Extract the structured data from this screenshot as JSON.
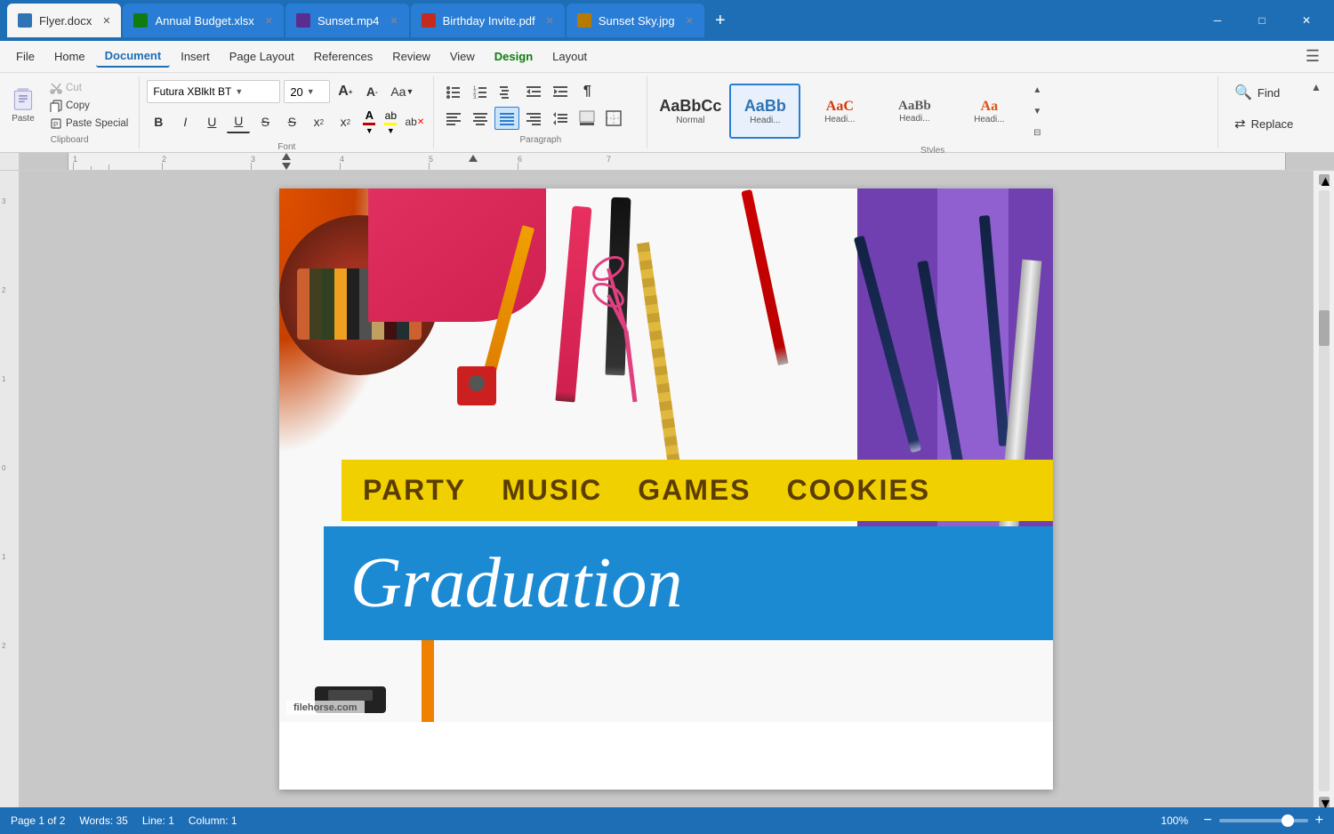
{
  "titlebar": {
    "tabs": [
      {
        "id": "flyer",
        "label": "Flyer.docx",
        "icon_color": "#1e6eb5",
        "active": true
      },
      {
        "id": "budget",
        "label": "Annual Budget.xlsx",
        "icon_color": "#107c10",
        "active": false
      },
      {
        "id": "sunset",
        "label": "Sunset.mp4",
        "icon_color": "#5c2d91",
        "active": false
      },
      {
        "id": "birthday",
        "label": "Birthday Invite.pdf",
        "icon_color": "#c42b1c",
        "active": false
      },
      {
        "id": "sunsetjpg",
        "label": "Sunset Sky.jpg",
        "icon_color": "#b77a00",
        "active": false
      }
    ],
    "add_tab": "+",
    "win_minimize": "─",
    "win_maximize": "□",
    "win_close": "✕"
  },
  "menubar": {
    "items": [
      {
        "id": "file",
        "label": "File"
      },
      {
        "id": "home",
        "label": "Home"
      },
      {
        "id": "document",
        "label": "Document",
        "active": true
      },
      {
        "id": "insert",
        "label": "Insert"
      },
      {
        "id": "pagelayout",
        "label": "Page Layout"
      },
      {
        "id": "references",
        "label": "References"
      },
      {
        "id": "review",
        "label": "Review"
      },
      {
        "id": "view",
        "label": "View"
      },
      {
        "id": "design",
        "label": "Design",
        "design": true
      },
      {
        "id": "layout",
        "label": "Layout"
      }
    ]
  },
  "ribbon": {
    "paste": {
      "paste_label": "Paste",
      "cut_label": "Cut",
      "copy_label": "Copy",
      "paste_special_label": "Paste Special"
    },
    "font": {
      "font_name": "Futura XBlkIt BT",
      "font_size": "20",
      "bold_label": "B",
      "italic_label": "I",
      "underline_label": "U",
      "strikethrough_label": "S",
      "double_underline_label": "U",
      "double_strikethrough_label": "S",
      "superscript_label": "x²",
      "subscript_label": "x₂",
      "font_color_label": "A",
      "highlight_label": "ab",
      "clear_format_label": "ab",
      "grow_label": "A",
      "shrink_label": "A"
    },
    "paragraph": {
      "bullets_label": "≡",
      "numbered_label": "≡",
      "multilevel_label": "≡",
      "indent_dec_label": "←",
      "indent_inc_label": "→",
      "show_para_label": "¶",
      "align_left_label": "≡",
      "align_center_label": "≡",
      "align_right_label": "≡",
      "align_justify_label": "≡",
      "line_spacing_label": "≡",
      "shading_label": "A",
      "borders_label": "□"
    },
    "styles": {
      "normal_label": "Normal",
      "heading1_label": "Headi...",
      "heading2_label": "Headi...",
      "heading3_label": "Headi...",
      "heading4_label": "Headi...",
      "normal_text": "AaBbCc",
      "heading1_text": "AaBb",
      "heading2_text": "AaC",
      "heading3_text": "AaBb",
      "heading4_text": "Aa"
    },
    "find_replace": {
      "find_label": "Find",
      "replace_label": "Replace"
    }
  },
  "document": {
    "banner_words": [
      "PARTY",
      "MUSIC",
      "GAMES",
      "COOKIES"
    ],
    "graduation_text": "Graduation",
    "watermark": "filehorse.com"
  },
  "statusbar": {
    "page_info": "Page 1 of 2",
    "words": "Words: 35",
    "line": "Line: 1",
    "column": "Column: 1",
    "zoom_percent": "100%",
    "zoom_minus": "−",
    "zoom_plus": "+"
  }
}
